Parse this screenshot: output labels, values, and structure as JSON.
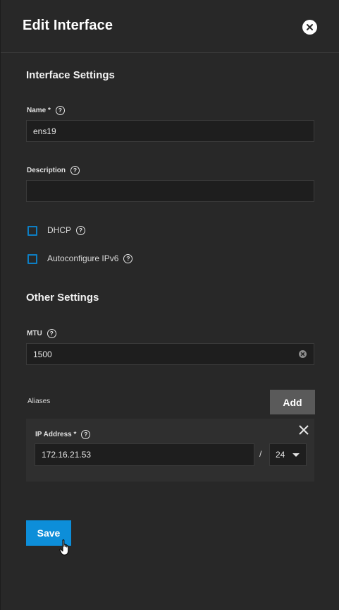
{
  "dialog": {
    "title": "Edit Interface",
    "close_icon": "close-circle-icon"
  },
  "interface_settings": {
    "section_title": "Interface Settings",
    "name": {
      "label": "Name *",
      "value": "ens19"
    },
    "description": {
      "label": "Description",
      "value": ""
    },
    "dhcp": {
      "label": "DHCP",
      "checked": false
    },
    "autoconfigure_ipv6": {
      "label": "Autoconfigure IPv6",
      "checked": false
    }
  },
  "other_settings": {
    "section_title": "Other Settings",
    "mtu": {
      "label": "MTU",
      "value": "1500"
    }
  },
  "aliases": {
    "label": "Aliases",
    "add_label": "Add",
    "items": [
      {
        "ip_label": "IP Address *",
        "ip_value": "172.16.21.53",
        "separator": "/",
        "netmask": "24"
      }
    ]
  },
  "actions": {
    "save_label": "Save"
  },
  "colors": {
    "accent": "#0d8ed9",
    "checkbox_border": "#0d7ec3",
    "background": "#282828",
    "input_bg": "#1e1e1e"
  }
}
